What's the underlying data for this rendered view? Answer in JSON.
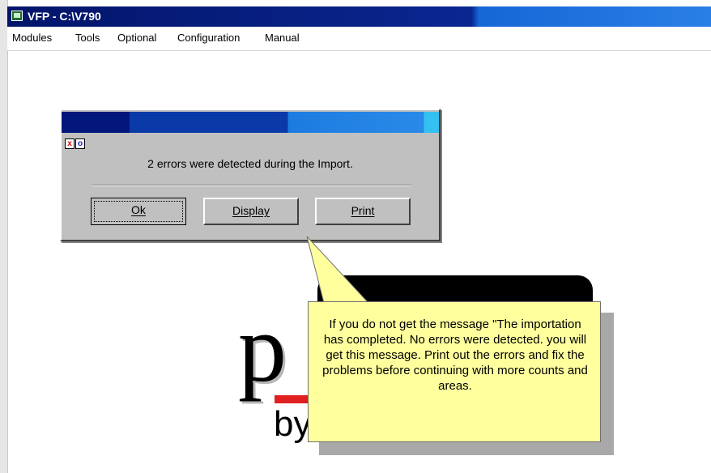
{
  "window": {
    "title": "VFP - C:\\V790"
  },
  "menu": [
    "Modules",
    "Tools",
    "Optional",
    "Configuration",
    "Manual"
  ],
  "dialog": {
    "controls": {
      "close": "x",
      "minimize": "o"
    },
    "message": "2 errors were detected during the Import.",
    "buttons": {
      "ok": "Ok",
      "display": "Display",
      "print": "Print"
    }
  },
  "logo": {
    "letters": "p",
    "byline": "by"
  },
  "callout": {
    "text": "If you do not get the message \"The importation has completed. No errors were detected. you will get this message. Print out the errors and fix the problems before continuing with more counts and areas."
  },
  "colors": {
    "titlebar": "#0a2690",
    "dialog_face": "#c0c0c0",
    "callout_bg": "#ffff9e",
    "logo_accent": "#e02020"
  },
  "icons": {
    "app": "app-icon"
  }
}
